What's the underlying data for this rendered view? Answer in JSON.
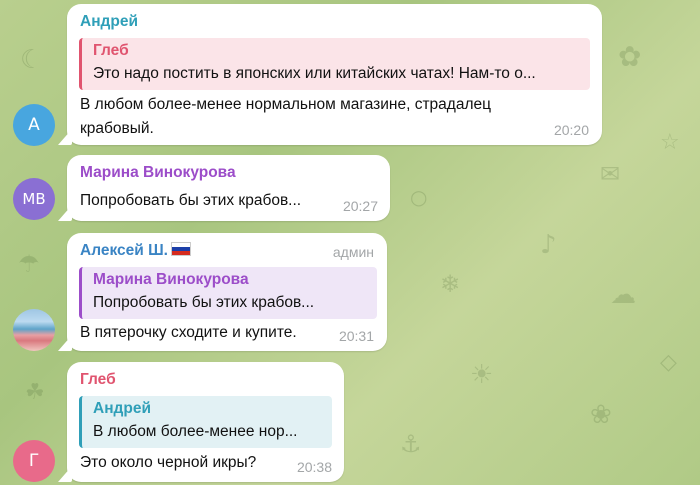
{
  "messages": [
    {
      "sender": "Андрей",
      "sender_color": "#2f9fb8",
      "avatar": {
        "initials": "А",
        "color": "#48a6df"
      },
      "reply": {
        "author": "Глеб",
        "text": "Это надо постить в японских или китайских чатах! Нам-то о...",
        "accent": "#e0546f"
      },
      "text_lines": [
        "В любом более-менее нормальном магазине, страдалец",
        "крабовый."
      ],
      "time": "20:20"
    },
    {
      "sender": "Марина Винокурова",
      "sender_color": "#9c4dc9",
      "avatar": {
        "initials": "МВ",
        "color": "#8a6fd3"
      },
      "text_lines": [
        "Попробовать бы этих крабов..."
      ],
      "time": "20:27"
    },
    {
      "sender": "Алексей Ш.",
      "sender_color": "#3a84c4",
      "role": "админ",
      "avatar": {
        "initials": "",
        "color": "#9fc6e3"
      },
      "reply": {
        "author": "Марина Винокурова",
        "text": "Попробовать бы этих крабов...",
        "accent": "#9c4dc9"
      },
      "text_lines": [
        "В пятерочку сходите и купите."
      ],
      "time": "20:31"
    },
    {
      "sender": "Глеб",
      "sender_color": "#e0546f",
      "avatar": {
        "initials": "Г",
        "color": "#e86a8a"
      },
      "reply": {
        "author": "Андрей",
        "text": "В любом более-менее нор...",
        "accent": "#2f9fb8"
      },
      "text_lines": [
        "Это около черной икры?"
      ],
      "time": "20:38"
    }
  ]
}
